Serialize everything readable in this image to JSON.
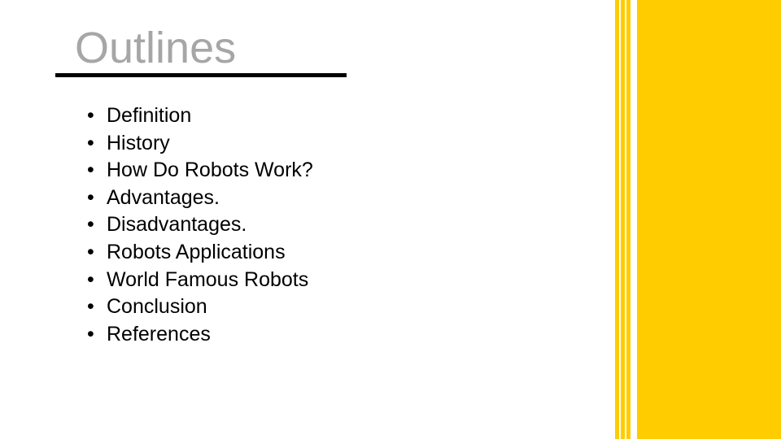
{
  "slide": {
    "title": "Outlines",
    "bullet_glyph": "•",
    "items": [
      "Definition",
      "History",
      "How Do Robots Work?",
      "Advantages.",
      "Disadvantages.",
      "Robots Applications",
      "World Famous Robots",
      "Conclusion",
      "References"
    ],
    "colors": {
      "accent": "#ffcc00",
      "title": "#a6a6a6",
      "text": "#000000"
    }
  }
}
